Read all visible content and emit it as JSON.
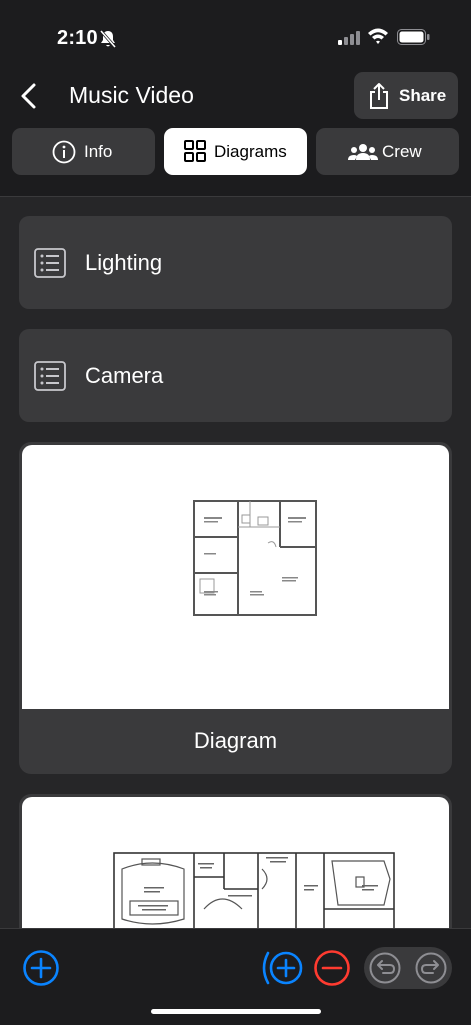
{
  "status_bar": {
    "time": "2:10"
  },
  "header": {
    "title": "Music Video",
    "share_label": "Share"
  },
  "tabs": [
    {
      "label": "Info",
      "icon": "info-icon"
    },
    {
      "label": "Diagrams",
      "icon": "grid-icon",
      "active": true
    },
    {
      "label": "Crew",
      "icon": "people-icon"
    }
  ],
  "lists": [
    {
      "label": "Lighting",
      "icon": "list-icon"
    },
    {
      "label": "Camera",
      "icon": "list-icon"
    }
  ],
  "diagrams": [
    {
      "caption": "Diagram"
    }
  ],
  "colors": {
    "accent": "#0a84ff",
    "danger": "#ff3b30",
    "card": "#3a3a3c"
  }
}
